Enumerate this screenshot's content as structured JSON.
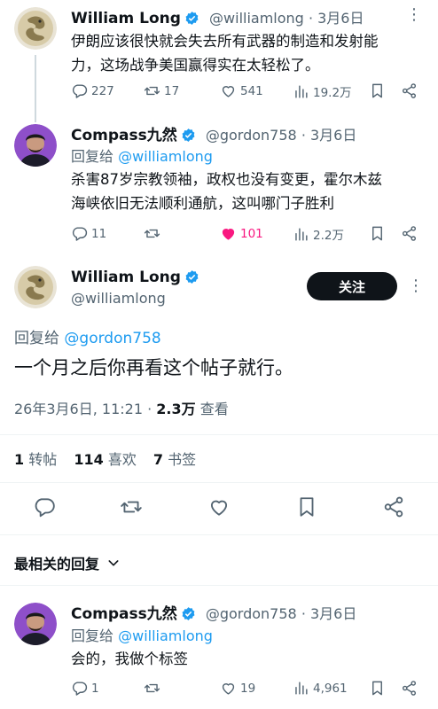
{
  "tweet1": {
    "name": "William Long",
    "handle": "@williamlong",
    "date": "· 3月6日",
    "text_line1": "伊朗应该很快就会失去所有武器的制造和发射能",
    "text_line2": "力，这场战争美国赢得实在太轻松了。",
    "replies": "227",
    "retweets": "17",
    "likes": "541",
    "views": "19.2万"
  },
  "tweet2": {
    "name": "Compass九然",
    "handle": "@gordon758",
    "date": "· 3月6日",
    "reply_prefix": "回复给",
    "reply_handle": "@williamlong",
    "text_line1": "杀害87岁宗教领袖，政权也没有变更，霍尔木兹",
    "text_line2": "海峡依旧无法顺利通航，这叫哪门子胜利",
    "replies": "11",
    "retweets": "",
    "likes": "101",
    "views": "2.2万"
  },
  "main": {
    "name": "William Long",
    "handle": "@williamlong",
    "follow_label": "关注",
    "reply_prefix": "回复给",
    "reply_handle": "@gordon758",
    "text": "一个月之后你再看这个帖子就行。",
    "timestamp": "26年3月6日, 11:21 · ",
    "views_count": "2.3万",
    "views_label": " 查看",
    "retweets_count": "1",
    "retweets_label": " 转帖",
    "likes_count": "114",
    "likes_label": " 喜欢",
    "bookmarks_count": "7",
    "bookmarks_label": " 书签"
  },
  "sort": {
    "label": "最相关的回复"
  },
  "reply": {
    "name": "Compass九然",
    "handle": "@gordon758",
    "date": "· 3月6日",
    "reply_prefix": "回复给",
    "reply_handle": "@williamlong",
    "text": "会的，我做个标签",
    "replies": "1",
    "retweets": "",
    "likes": "19",
    "views": "4,961"
  },
  "colors": {
    "accent": "#1d9bf0",
    "like_active": "#f91880",
    "muted": "#536471",
    "text": "#0f1419"
  },
  "icons": [
    "more-icon",
    "reply-icon",
    "retweet-icon",
    "like-icon",
    "views-icon",
    "bookmark-icon",
    "share-icon",
    "verified-icon",
    "chevron-down-icon"
  ]
}
